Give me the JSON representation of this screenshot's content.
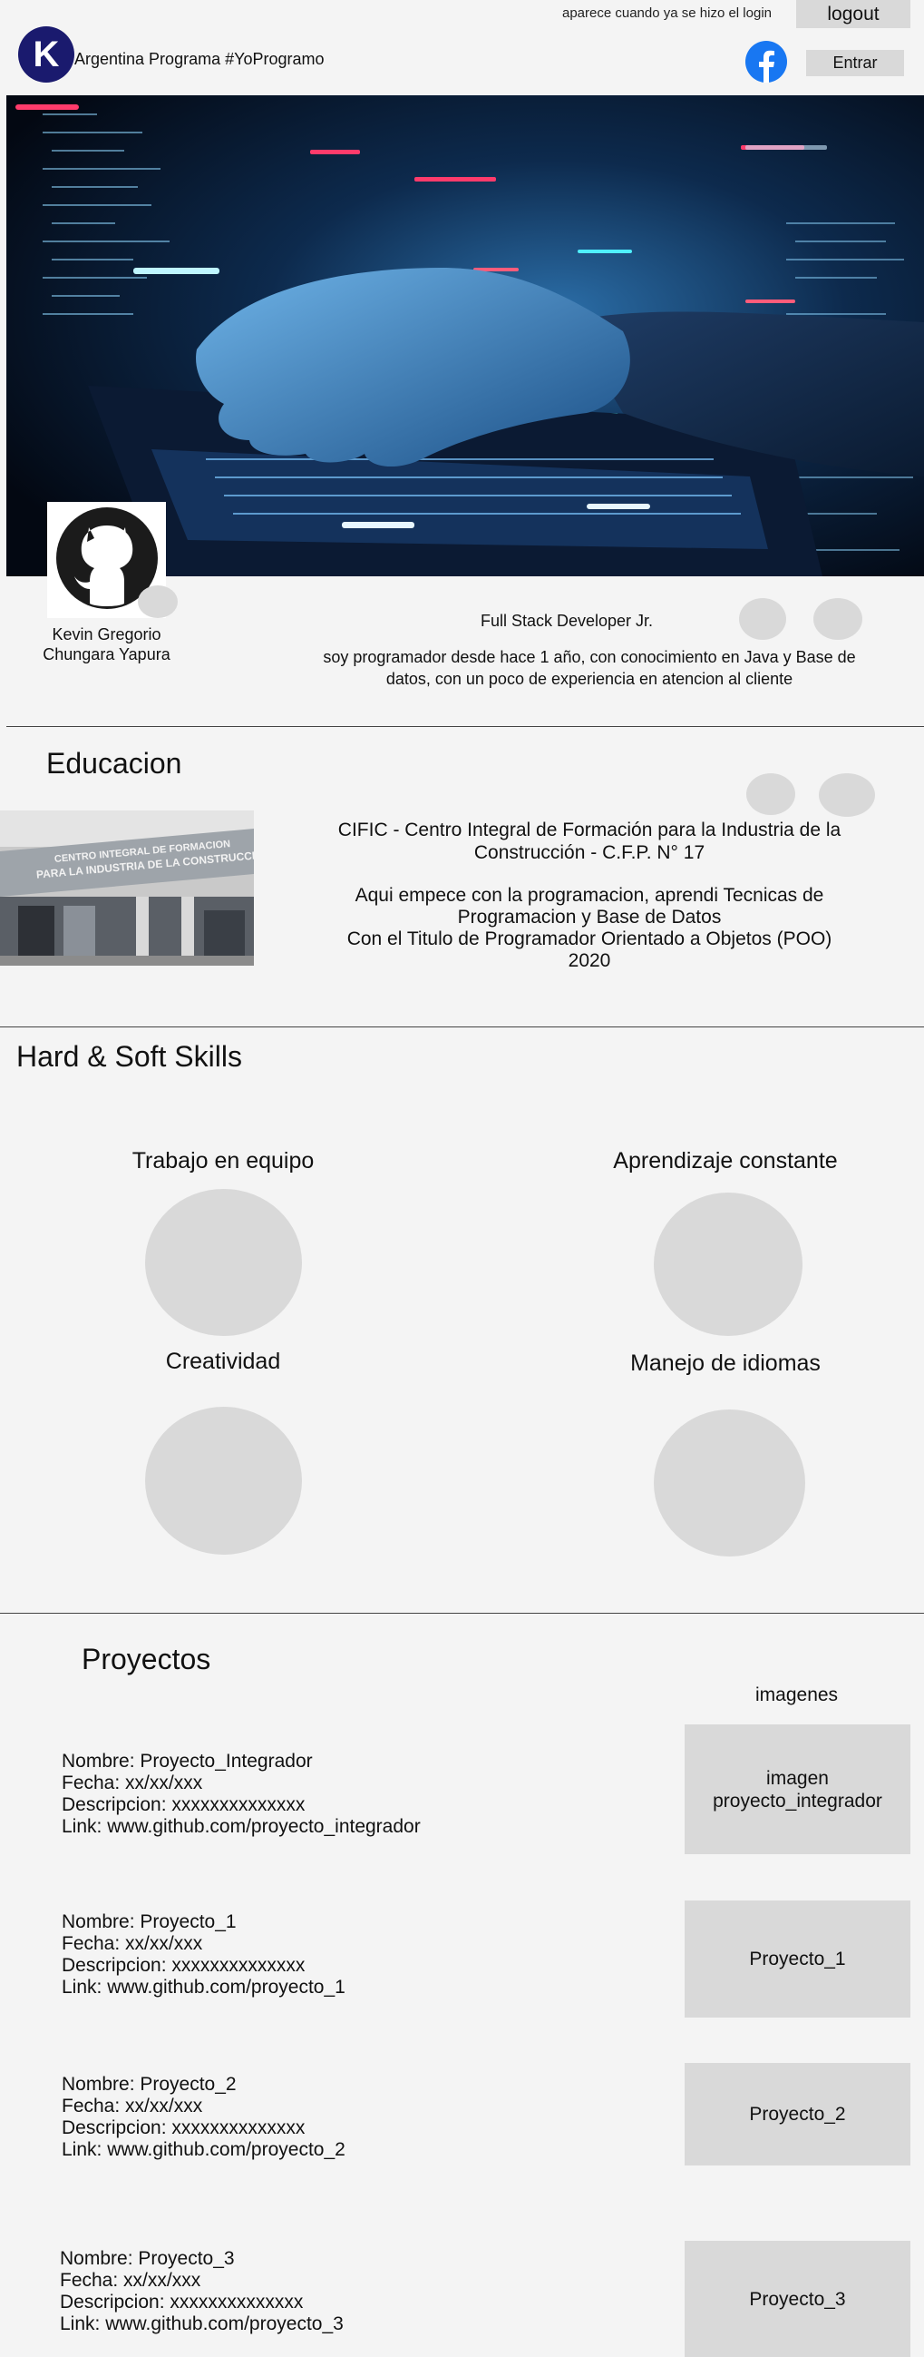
{
  "header": {
    "login_note": "aparece cuando ya se hizo el login",
    "logout_label": "logout",
    "logo_letter": "K",
    "brand": "Argentina Programa #YoProgramo",
    "login_label": "Entrar"
  },
  "profile": {
    "name_line1": "Kevin Gregorio",
    "name_line2": "Chungara Yapura",
    "role": "Full Stack Developer Jr.",
    "bio_line1": "soy programador desde hace 1 año, con conocimiento en Java y Base de",
    "bio_line2": "datos, con un poco de experiencia en atencion al cliente",
    "building_sign_line1": "CENTRO INTEGRAL DE FORMACION",
    "building_sign_line2": "PARA LA INDUSTRIA DE LA CONSTRUCCION"
  },
  "education": {
    "title": "Educacion",
    "school_line1": "CIFIC - Centro Integral de Formación para la Industria de la",
    "school_line2": "Construcción - C.F.P. N° 17",
    "desc_line1": "Aqui empece con la programacion, aprendi Tecnicas de",
    "desc_line2": "Programacion y Base de Datos",
    "desc_line3": "Con el Titulo de Programador Orientado a Objetos (POO)",
    "desc_line4": "2020"
  },
  "skills": {
    "title": "Hard & Soft Skills",
    "items": [
      {
        "label": "Trabajo en equipo"
      },
      {
        "label": "Aprendizaje constante"
      },
      {
        "label": "Creatividad"
      },
      {
        "label": "Manejo de idiomas"
      }
    ]
  },
  "projects": {
    "title": "Proyectos",
    "images_label": "imagenes",
    "items": [
      {
        "nombre": "Nombre: Proyecto_Integrador",
        "fecha": "Fecha: xx/xx/xxx",
        "descripcion": "Descripcion: xxxxxxxxxxxxxx",
        "link": "Link: www.github.com/proyecto_integrador",
        "image_line1": "imagen",
        "image_line2": "proyecto_integrador"
      },
      {
        "nombre": "Nombre: Proyecto_1",
        "fecha": "Fecha: xx/xx/xxx",
        "descripcion": "Descripcion: xxxxxxxxxxxxxx",
        "link": "Link: www.github.com/proyecto_1",
        "image_line1": "Proyecto_1",
        "image_line2": ""
      },
      {
        "nombre": "Nombre: Proyecto_2",
        "fecha": "Fecha: xx/xx/xxx",
        "descripcion": "Descripcion: xxxxxxxxxxxxxx",
        "link": "Link: www.github.com/proyecto_2",
        "image_line1": "Proyecto_2",
        "image_line2": ""
      },
      {
        "nombre": "Nombre: Proyecto_3",
        "fecha": "Fecha: xx/xx/xxx",
        "descripcion": "Descripcion: xxxxxxxxxxxxxx",
        "link": "Link: www.github.com/proyecto_3",
        "image_line1": "Proyecto_3",
        "image_line2": ""
      }
    ]
  }
}
